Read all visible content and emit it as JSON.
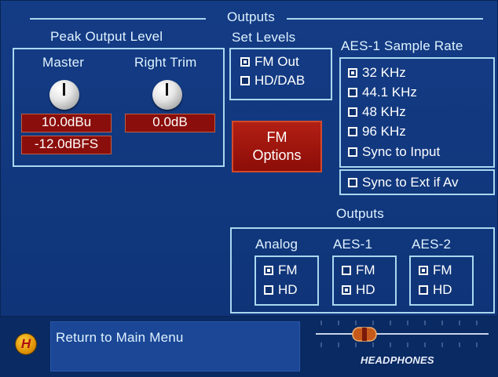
{
  "title": "Outputs",
  "peak_output": {
    "heading": "Peak Output Level",
    "master": {
      "label": "Master",
      "value1": "10.0dBu",
      "value2": "-12.0dBFS"
    },
    "right_trim": {
      "label": "Right Trim",
      "value": "0.0dB"
    }
  },
  "set_levels": {
    "heading": "Set Levels",
    "items": [
      {
        "label": "FM Out",
        "checked": true
      },
      {
        "label": "HD/DAB",
        "checked": false
      }
    ]
  },
  "fm_options": {
    "line1": "FM",
    "line2": "Options"
  },
  "aes_sample_rate": {
    "heading": "AES-1 Sample Rate",
    "items": [
      {
        "label": "32 KHz",
        "checked": true
      },
      {
        "label": "44.1 KHz",
        "checked": false
      },
      {
        "label": "48 KHz",
        "checked": false
      },
      {
        "label": "96 KHz",
        "checked": false
      },
      {
        "label": "Sync to Input",
        "checked": false
      }
    ],
    "sync_ext": {
      "label": "Sync to Ext if Av",
      "checked": false
    }
  },
  "outputs": {
    "heading": "Outputs",
    "groups": [
      {
        "label": "Analog",
        "fm": true,
        "hd": false
      },
      {
        "label": "AES-1",
        "fm": false,
        "hd": true
      },
      {
        "label": "AES-2",
        "fm": true,
        "hd": false
      }
    ],
    "fm_label": "FM",
    "hd_label": "HD"
  },
  "footer": {
    "logo_letter": "H",
    "menu_text": "Return to Main Menu",
    "slider_label": "HEADPHONES"
  },
  "colors": {
    "background": "#0d2f6b",
    "frame": "#a9d8ef",
    "readout": "#8a0e0b",
    "button": "#b21f14"
  }
}
